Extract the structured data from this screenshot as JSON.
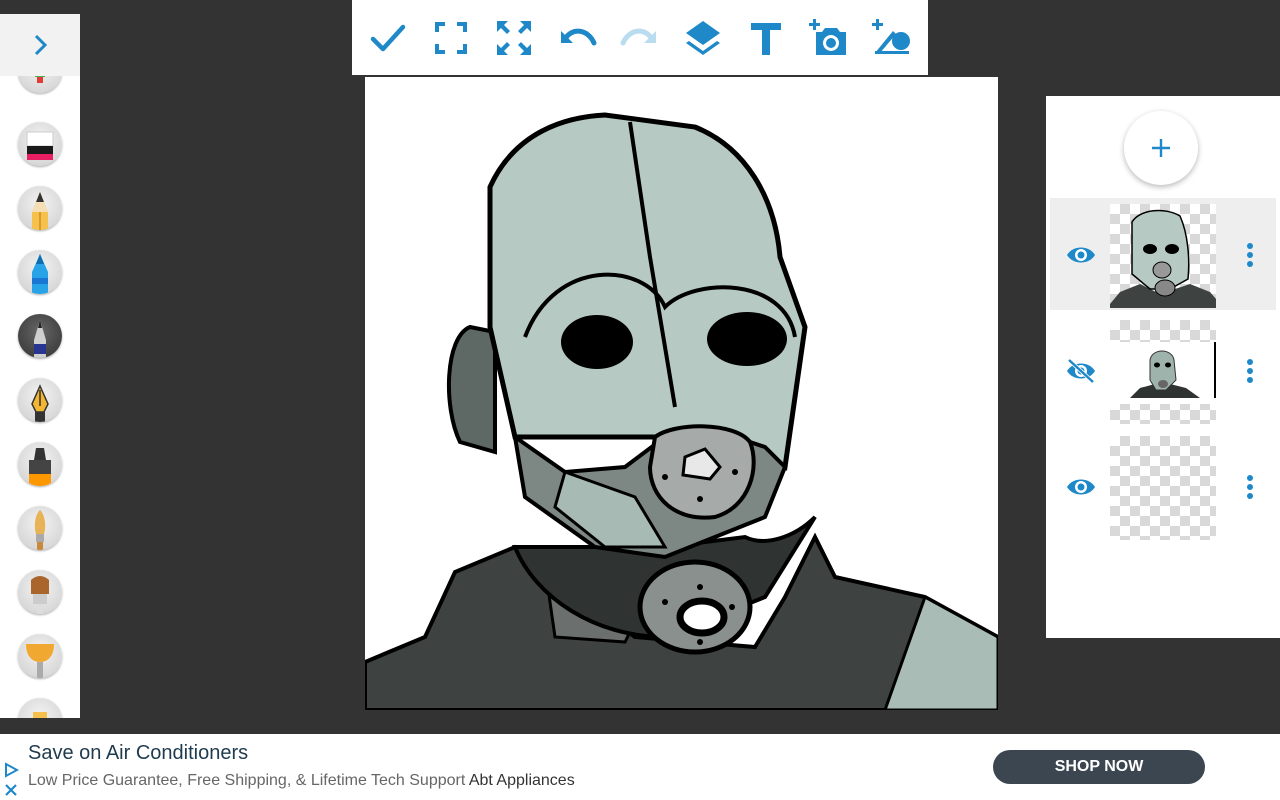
{
  "toolbar": {
    "buttons": [
      {
        "name": "done-button",
        "icon": "check-icon"
      },
      {
        "name": "fit-screen-button",
        "icon": "crop-free-icon"
      },
      {
        "name": "fullscreen-button",
        "icon": "expand-arrows-icon"
      },
      {
        "name": "undo-button",
        "icon": "undo-icon"
      },
      {
        "name": "redo-button",
        "icon": "redo-icon",
        "disabled": true
      },
      {
        "name": "layers-button",
        "icon": "layers-icon"
      },
      {
        "name": "text-button",
        "icon": "text-T-icon"
      },
      {
        "name": "add-photo-button",
        "icon": "add-camera-icon"
      },
      {
        "name": "add-shape-button",
        "icon": "add-shape-icon"
      }
    ],
    "accent_color": "#1e88c8",
    "disabled_color": "#b9dcef"
  },
  "brush_panel": {
    "toggle_icon": "chevron-right-icon",
    "brushes": [
      {
        "name": "marker-green",
        "icon": "marker-icon"
      },
      {
        "name": "eraser",
        "icon": "eraser-icon"
      },
      {
        "name": "pencil",
        "icon": "pencil-icon"
      },
      {
        "name": "crayon-blue",
        "icon": "crayon-icon"
      },
      {
        "name": "fineliner",
        "icon": "fineliner-icon"
      },
      {
        "name": "fountain-pen",
        "icon": "fountain-pen-icon"
      },
      {
        "name": "highlighter",
        "icon": "highlighter-icon"
      },
      {
        "name": "round-brush",
        "icon": "round-brush-icon"
      },
      {
        "name": "flat-brush",
        "icon": "flat-brush-icon"
      },
      {
        "name": "fan-brush",
        "icon": "fan-brush-icon"
      },
      {
        "name": "more-brush",
        "icon": "brush-icon"
      }
    ]
  },
  "layers": {
    "add_icon": "plus-icon",
    "items": [
      {
        "name": "layer-1",
        "visible": true,
        "selected": true
      },
      {
        "name": "layer-2",
        "visible": false,
        "selected": false
      },
      {
        "name": "layer-3",
        "visible": true,
        "selected": false
      }
    ]
  },
  "ad": {
    "title": "Save on Air Conditioners",
    "subtitle": "Low Price Guarantee, Free Shipping, & Lifetime Tech Support",
    "advertiser": "Abt Appliances",
    "cta": "SHOP NOW"
  }
}
